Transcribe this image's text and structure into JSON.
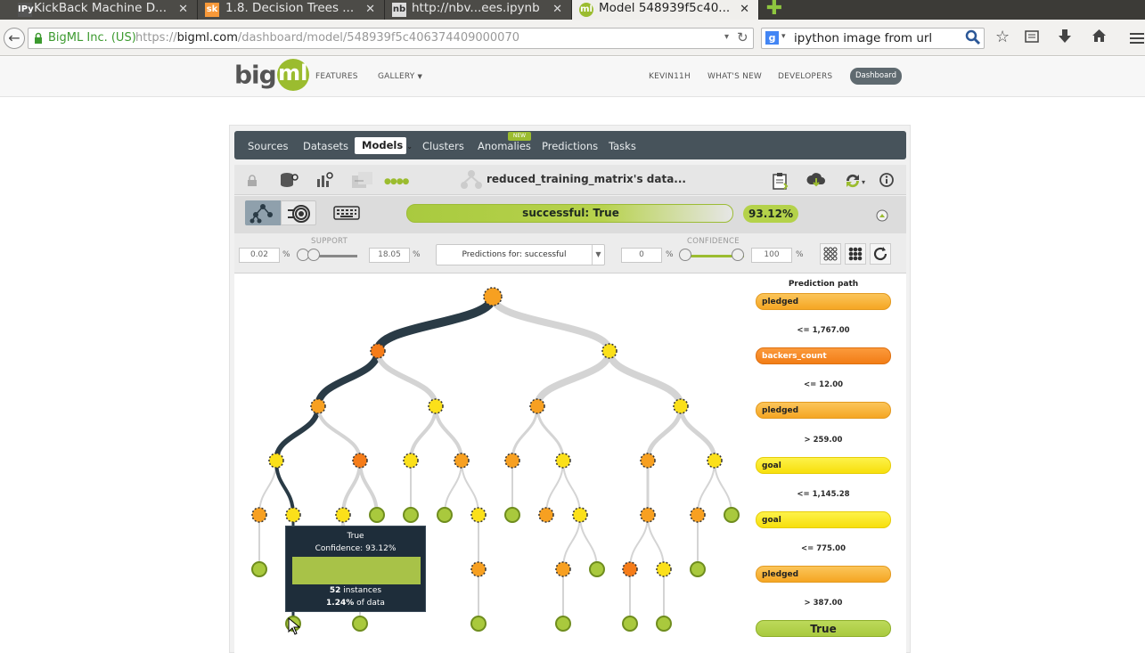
{
  "browser": {
    "tabs": [
      {
        "label": "KickBack Machine D...",
        "icon": "IPy"
      },
      {
        "label": "1.8. Decision Trees ...",
        "icon": "sk"
      },
      {
        "label": "http://nbv...ees.ipynb",
        "icon": "nb"
      },
      {
        "label": "Model 548939f5c40...",
        "icon": "ml"
      }
    ],
    "identity": "BigML Inc. (US)",
    "url_scheme": "https://",
    "url_host": "bigml.com",
    "url_path": "/dashboard/model/548939f5c406374409000070",
    "search_engine_icon": "g",
    "search_value": "ipython image from url"
  },
  "site": {
    "logo_text_1": "big",
    "logo_text_2": "ml",
    "nav_left": [
      "FEATURES",
      "GALLERY"
    ],
    "nav_right": [
      "KEVIN11H",
      "WHAT'S NEW",
      "DEVELOPERS"
    ],
    "dashboard_button": "Dashboard"
  },
  "appnav": {
    "items": [
      "Sources",
      "Datasets",
      "Models",
      "Clusters",
      "Anomalies",
      "Predictions",
      "Tasks"
    ],
    "new_badge": "NEW",
    "active": "Models"
  },
  "model": {
    "title": "reduced_training_matrix's data...",
    "objective": "successful: True",
    "confidence_badge": "93.12%"
  },
  "filters": {
    "support_label": "SUPPORT",
    "support_min": "0.02",
    "support_max": "18.05",
    "predictions_for": "Predictions for: successful",
    "confidence_label": "CONFIDENCE",
    "confidence_min": "0",
    "confidence_max": "100",
    "percent": "%"
  },
  "tooltip": {
    "class": "True",
    "confidence_line": "Confidence: 93.12%",
    "instances_num": "52",
    "instances_text": " instances",
    "data_pct": "1.24%",
    "data_text": " of data"
  },
  "prediction_path": {
    "title": "Prediction path",
    "steps": [
      {
        "field": "pledged",
        "style": "ppo"
      },
      {
        "condition": "<= 1,767.00"
      },
      {
        "field": "backers_count",
        "style": "ppd"
      },
      {
        "condition": "<= 12.00"
      },
      {
        "field": "pledged",
        "style": "ppo"
      },
      {
        "condition": "> 259.00"
      },
      {
        "field": "goal",
        "style": "ppy"
      },
      {
        "condition": "<= 1,145.28"
      },
      {
        "field": "goal",
        "style": "ppy"
      },
      {
        "condition": "<= 775.00"
      },
      {
        "field": "pledged",
        "style": "ppo"
      },
      {
        "condition": "> 387.00"
      },
      {
        "field": "True",
        "style": "ppg"
      }
    ]
  },
  "colors": {
    "node_dark_orange": "#f57c19",
    "node_orange": "#f7a021",
    "node_yellow": "#fbe01a",
    "node_green": "#a9c93d",
    "path": "#2a3b46",
    "edge": "#d4d4d4"
  },
  "icons": [
    "lock-icon",
    "dataset-icon",
    "chart-icon",
    "settings-icon",
    "tree-view-icon",
    "sunburst-icon",
    "keyboard-icon",
    "clipboard-icon",
    "download-icon",
    "action-icon",
    "info-icon",
    "refresh-icon",
    "expand-icon",
    "collapse-icon",
    "up-arrow-icon"
  ]
}
